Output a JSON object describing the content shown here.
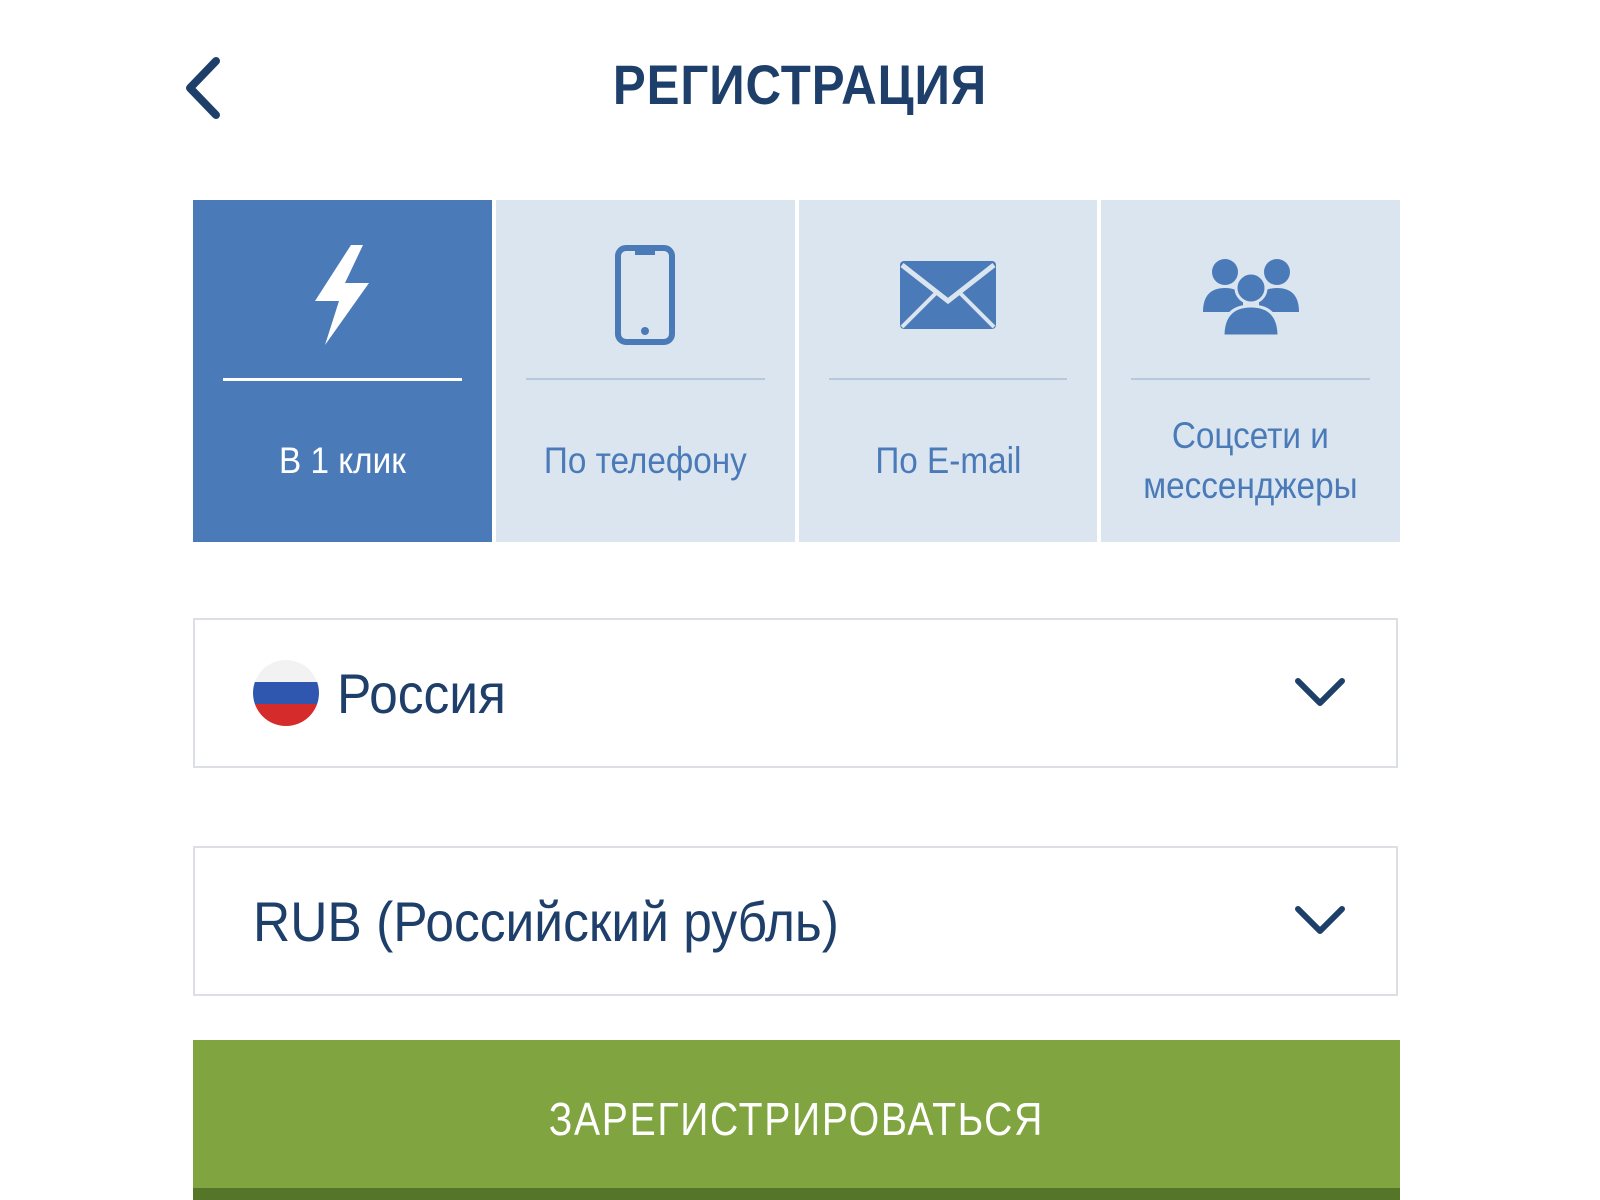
{
  "header": {
    "back_icon": "chevron-left-icon",
    "title": "РЕГИСТРАЦИЯ"
  },
  "tabs": [
    {
      "id": "one-click",
      "label": "В 1 клик",
      "icon": "lightning-icon",
      "active": true
    },
    {
      "id": "phone",
      "label": "По телефону",
      "icon": "smartphone-icon",
      "active": false
    },
    {
      "id": "email",
      "label": "По E-mail",
      "icon": "envelope-icon",
      "active": false
    },
    {
      "id": "social",
      "label": "Соцсети и\nмессенджеры",
      "icon": "users-group-icon",
      "active": false
    }
  ],
  "form": {
    "country": {
      "value": "Россия",
      "flag_icon": "russia-flag-icon",
      "dropdown_icon": "chevron-down-icon"
    },
    "currency": {
      "value": "RUB (Российский рубль)",
      "dropdown_icon": "chevron-down-icon"
    },
    "submit_label": "ЗАРЕГИСТРИРОВАТЬСЯ"
  },
  "colors": {
    "primary_text": "#1f3f6b",
    "tab_active_bg": "#4a7ab8",
    "tab_inactive_bg": "#dae5f0",
    "submit_bg": "#80a43f",
    "submit_shadow": "#557529"
  }
}
